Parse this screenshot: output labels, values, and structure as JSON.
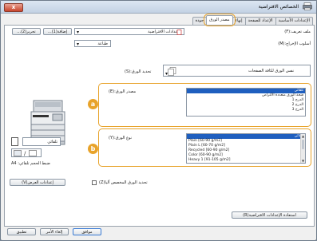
{
  "window": {
    "title": "الخصائص الافتراضية",
    "close_label": "x"
  },
  "tabs": [
    {
      "label": "الإعدادات الأساسية",
      "active": false
    },
    {
      "label": "الإعداد للصفحة",
      "active": false
    },
    {
      "label": "إنهاء",
      "active": false
    },
    {
      "label": "مصدر الورق",
      "active": true
    },
    {
      "label": "جودة",
      "active": false
    }
  ],
  "profile": {
    "label": "ملف تعريف:(F)",
    "value": "الإعدادات الافتراضية",
    "add_button": "إضافة(1)...",
    "edit_button": "تحرير(2)..."
  },
  "output_method": {
    "label": "أسلوب الإخراج:(M)",
    "value": "طباعة"
  },
  "paper_selection": {
    "label": "تحديد الورق:(S)",
    "value": "نفس الورق لكافة الصفحات"
  },
  "paper_source": {
    "label": "مصدر الورق:(E)",
    "badge": "a",
    "items": [
      "تلقائي",
      "فتحة الورق متعددة الأغراض",
      "الدرج 1",
      "الدرج 2",
      "الدرج 3"
    ],
    "selected_index": 0
  },
  "paper_type": {
    "label": "نوع الورق:(Y)",
    "badge": "b",
    "items": [
      "تلقائي",
      "Plain [60-90 g/m2]",
      "Plain L [60-70 g/m2]",
      "Recycled [60-90 g/m2]",
      "Color [60-90 g/m2]",
      "Heavy 1 [91-105 g/m2]"
    ],
    "selected_index": 0
  },
  "preview": {
    "mode_value": "تلقائي",
    "status_text": "ضبط الحجم تلقائي: A4",
    "view_settings_button": "إعدادات العرض(V)"
  },
  "manual_feed": {
    "label": "تحديد الورق المخصص آليا(Z)",
    "checked": false
  },
  "restore_defaults_button": "استعادة الإعدادات الافتراضية(R)",
  "footer": {
    "ok": "موافق",
    "cancel": "إلغاء الأمر",
    "apply": "تطبيق"
  },
  "colors": {
    "accent": "#e8a32a",
    "selection": "#1f5fbf"
  }
}
